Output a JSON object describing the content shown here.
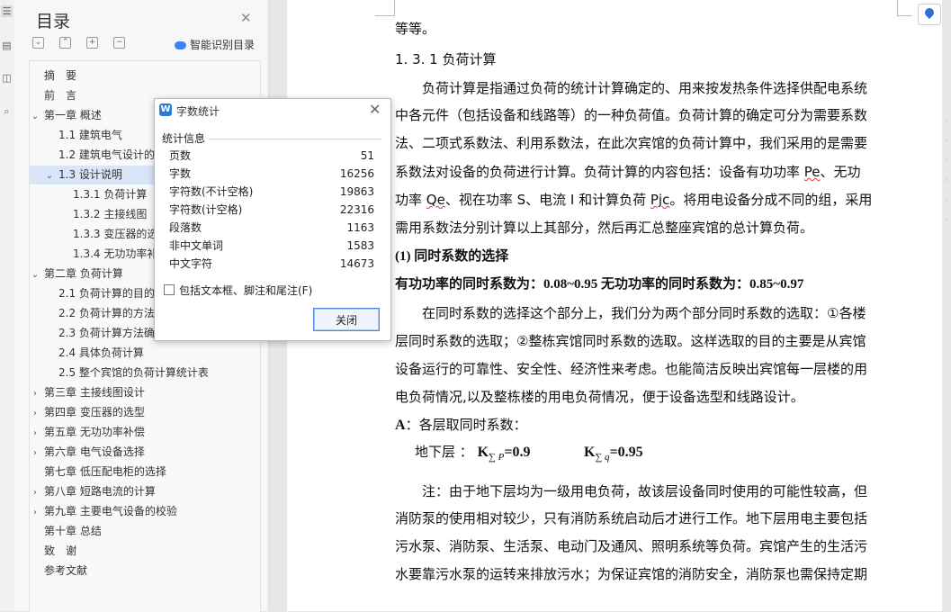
{
  "left_strip": {
    "icons": [
      "list-icon",
      "doc-icon",
      "bookmark-icon",
      "search-icon"
    ]
  },
  "toc": {
    "title": "目录",
    "smart_label": "智能识别目录",
    "items": [
      {
        "label": "摘　要",
        "level": 0,
        "arrow": ""
      },
      {
        "label": "前　言",
        "level": 0,
        "arrow": ""
      },
      {
        "label": "第一章  概述",
        "level": 0,
        "arrow": "⌄"
      },
      {
        "label": "1.1 建筑电气",
        "level": 1,
        "arrow": ""
      },
      {
        "label": "1.2 建筑电气设计的",
        "level": 1,
        "arrow": ""
      },
      {
        "label": "1.3 设计说明",
        "level": 1,
        "arrow": "⌄"
      },
      {
        "label": "1.3.1 负荷计算",
        "level": 2,
        "arrow": ""
      },
      {
        "label": "1.3.2 主接线图",
        "level": 2,
        "arrow": ""
      },
      {
        "label": "1.3.3 变压器的选",
        "level": 2,
        "arrow": ""
      },
      {
        "label": "1.3.4 无功功率补",
        "level": 2,
        "arrow": ""
      },
      {
        "label": "第二章  负荷计算",
        "level": 0,
        "arrow": "⌄"
      },
      {
        "label": "2.1 负荷计算的目的",
        "level": 1,
        "arrow": ""
      },
      {
        "label": "2.2 负荷计算的方法",
        "level": 1,
        "arrow": ""
      },
      {
        "label": "2.3 负荷计算方法确",
        "level": 1,
        "arrow": ""
      },
      {
        "label": "2.4 具体负荷计算",
        "level": 1,
        "arrow": ""
      },
      {
        "label": "2.5  整个宾馆的负荷计算统计表",
        "level": 1,
        "arrow": ""
      },
      {
        "label": "第三章  主接线图设计",
        "level": 0,
        "arrow": "›"
      },
      {
        "label": "第四章  变压器的选型",
        "level": 0,
        "arrow": "›"
      },
      {
        "label": "第五章  无功功率补偿",
        "level": 0,
        "arrow": "›"
      },
      {
        "label": "第六章  电气设备选择",
        "level": 0,
        "arrow": "›"
      },
      {
        "label": "第七章  低压配电柜的选择",
        "level": 0,
        "arrow": ""
      },
      {
        "label": "第八章  短路电流的计算",
        "level": 0,
        "arrow": "›"
      },
      {
        "label": "第九章  主要电气设备的校验",
        "level": 0,
        "arrow": "›"
      },
      {
        "label": "第十章  总结",
        "level": 0,
        "arrow": ""
      },
      {
        "label": "致　谢",
        "level": 0,
        "arrow": ""
      },
      {
        "label": "参考文献",
        "level": 0,
        "arrow": ""
      }
    ],
    "selected_index": 5
  },
  "doc": {
    "lines": {
      "l0": "等等。",
      "l1": "1. 3. 1 负荷计算",
      "l2": "负荷计算是指通过负荷的统计计算确定的、用来按发热条件选择供配电系统",
      "l3": "中各元件（包括设备和线路等）的一种负荷值。负荷计算的确定可分为需要系数",
      "l4": "法、二项式系数法、利用系数法，在此次宾馆的负荷计算中，我们采用的是需要",
      "l5a": "系数法对设备的负荷进行计算。负荷计算的内容包括：设备有功功率 ",
      "l5b": "Pe",
      "l5c": "、无功",
      "l6a": "功率 ",
      "l6b": "Qe",
      "l6c": "、视在功率 S、电流 I 和计算负荷 ",
      "l6d": "Pjc",
      "l6e": "。将用电设备分成不同的组，采用",
      "l7": "需用系数法分别计算以上其部分，然后再汇总整座宾馆的总计算负荷。",
      "l8": " (1)  同时系数的选择",
      "l9": "有功功率的同时系数为：0.08~0.95      无功功率的同时系数为：0.85~0.97",
      "l10": "在同时系数的选择这个部分上，我们分为两个部分同时系数的选取：①各楼",
      "l11": "层同时系数的选取；②整栋宾馆同时系数的选取。这样选取的目的主要是从宾馆",
      "l12": "设备运行的可靠性、安全性、经济性来考虑。也能简洁反映出宾馆每一层楼的用",
      "l13": "电负荷情况,以及整栋楼的用电负荷情况，便于设备选型和线路设计。",
      "l14a": "A",
      "l14b": "：各层取同时系数：",
      "l15_label": "地下层 ：",
      "l15_k": "K",
      "l15_sub1": "∑ P",
      "l15_v1": "=0.9",
      "l15_sub2": "∑ q",
      "l15_v2": "=0.95",
      "l16": "注：由于地下层均为一级用电负荷，故该层设备同时使用的可能性较高，但",
      "l17": "消防泵的使用相对较少，只有消防系统启动后才进行工作。地下层用电主要包括",
      "l18": "污水泵、消防泵、生活泵、电动门及通风、照明系统等负荷。宾馆产生的生活污",
      "l19": "水要靠污水泵的运转来排放污水；为保证宾馆的消防安全，消防泵也需保持定期"
    }
  },
  "dialog": {
    "title": "字数统计",
    "section": "统计信息",
    "stats": [
      {
        "label": "页数",
        "value": "51"
      },
      {
        "label": "字数",
        "value": "16256"
      },
      {
        "label": "字符数(不计空格)",
        "value": "19863"
      },
      {
        "label": "字符数(计空格)",
        "value": "22316"
      },
      {
        "label": "段落数",
        "value": "1163"
      },
      {
        "label": "非中文单词",
        "value": "1583"
      },
      {
        "label": "中文字符",
        "value": "14673"
      }
    ],
    "checkbox_label": "包括文本框、脚注和尾注(F)",
    "checkbox_checked": false,
    "close_label": "关闭"
  }
}
